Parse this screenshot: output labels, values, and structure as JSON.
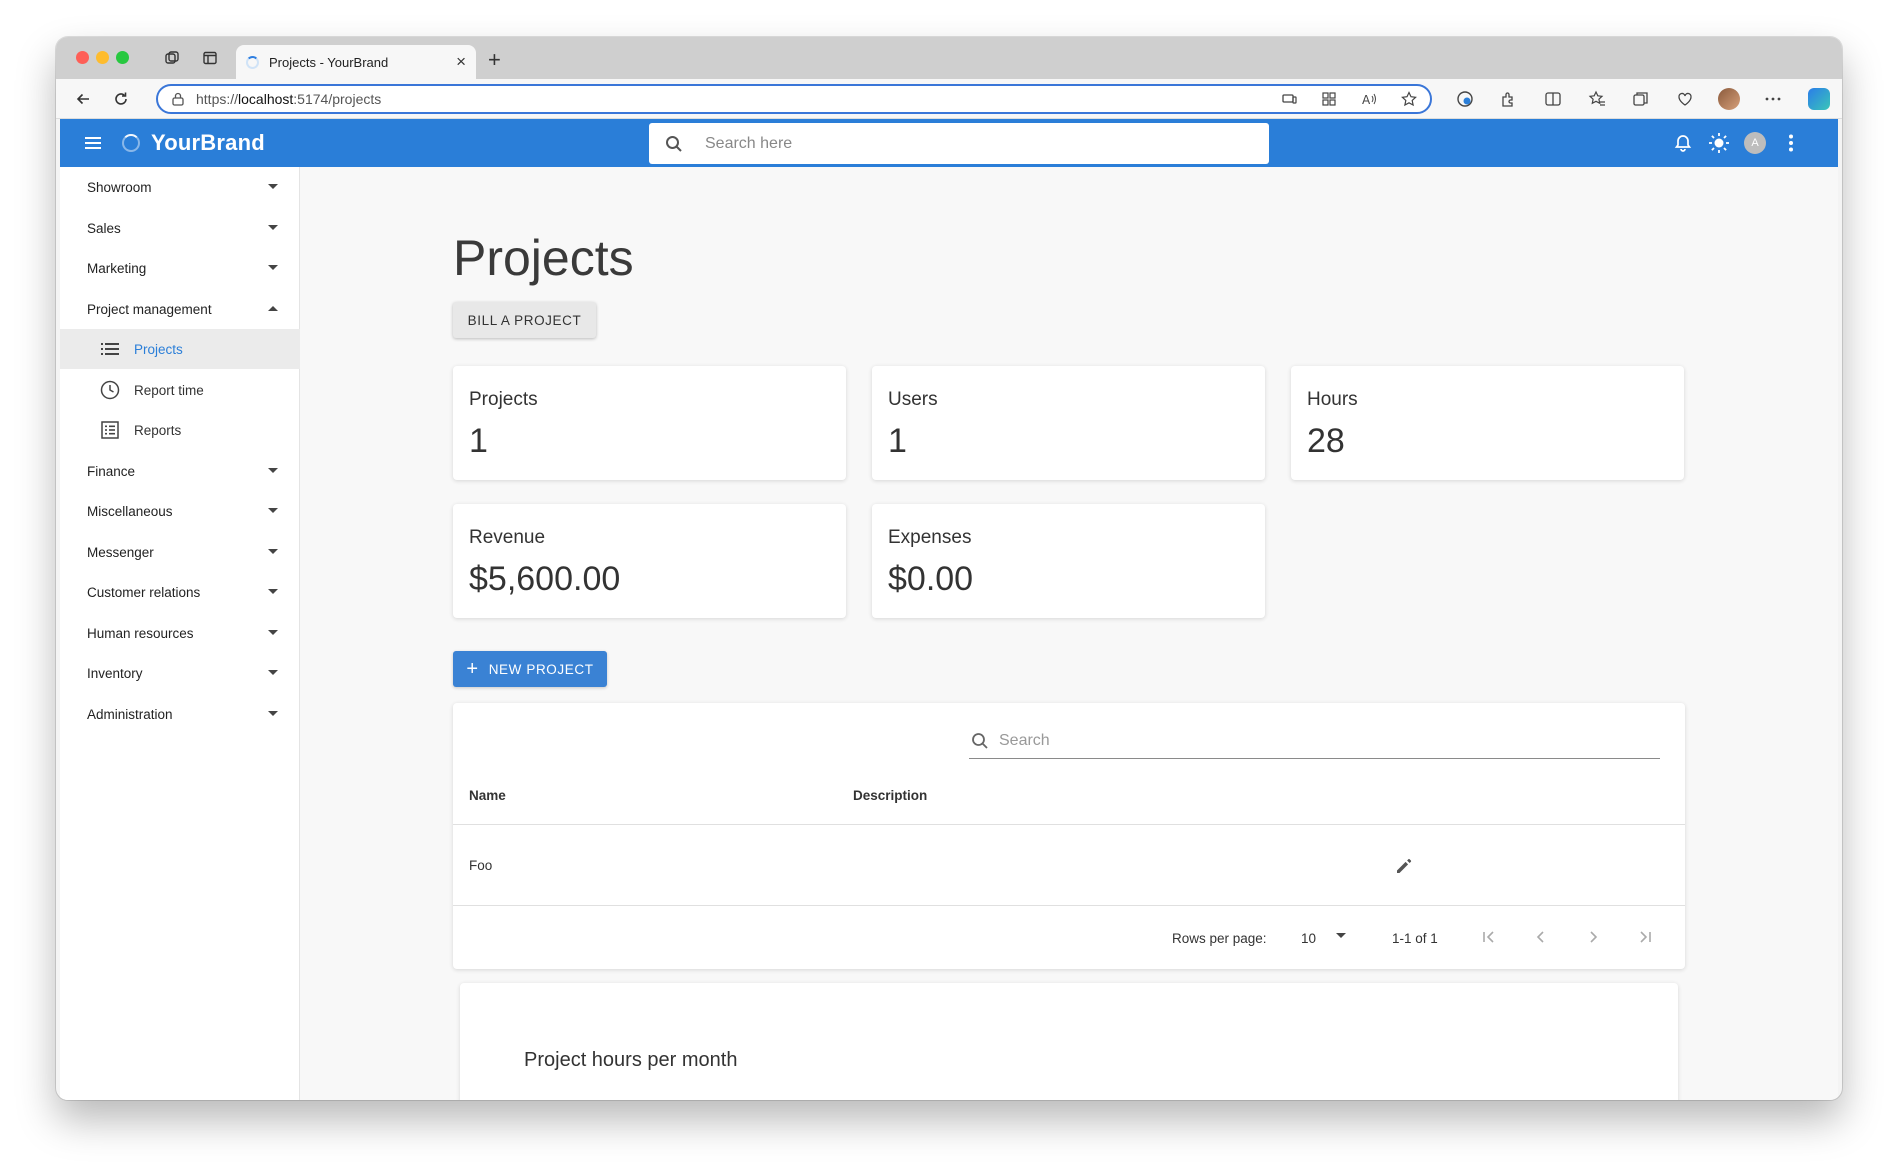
{
  "browser": {
    "tab_title": "Projects - YourBrand",
    "url_prefix": "https://",
    "url_host": "localhost",
    "url_rest": ":5174/projects"
  },
  "appbar": {
    "brand": "YourBrand",
    "search_placeholder": "Search here",
    "avatar_initial": "A"
  },
  "sidebar": {
    "items": [
      {
        "label": "Showroom"
      },
      {
        "label": "Sales"
      },
      {
        "label": "Marketing"
      },
      {
        "label": "Project management"
      },
      {
        "label": "Finance"
      },
      {
        "label": "Miscellaneous"
      },
      {
        "label": "Messenger"
      },
      {
        "label": "Customer relations"
      },
      {
        "label": "Human resources"
      },
      {
        "label": "Inventory"
      },
      {
        "label": "Administration"
      }
    ],
    "sub_items": [
      {
        "label": "Projects",
        "icon": "list-icon",
        "active": true
      },
      {
        "label": "Report time",
        "icon": "clock-icon",
        "active": false
      },
      {
        "label": "Reports",
        "icon": "report-icon",
        "active": false
      }
    ]
  },
  "main": {
    "title": "Projects",
    "bill_button": "BILL A PROJECT",
    "kpis": [
      {
        "label": "Projects",
        "value": "1"
      },
      {
        "label": "Users",
        "value": "1"
      },
      {
        "label": "Hours",
        "value": "28"
      },
      {
        "label": "Revenue",
        "value": "$5,600.00"
      },
      {
        "label": "Expenses",
        "value": "$0.00"
      }
    ],
    "new_project_button": "NEW PROJECT",
    "table": {
      "search_placeholder": "Search",
      "columns": [
        "Name",
        "Description"
      ],
      "rows": [
        {
          "name": "Foo",
          "description": ""
        }
      ],
      "rows_per_page_label": "Rows per page:",
      "rows_per_page_value": "10",
      "range_label": "1-1 of 1"
    },
    "chart_title": "Project hours per month"
  },
  "colors": {
    "primary": "#2a7ed8",
    "button_blue": "#3a82d4"
  }
}
